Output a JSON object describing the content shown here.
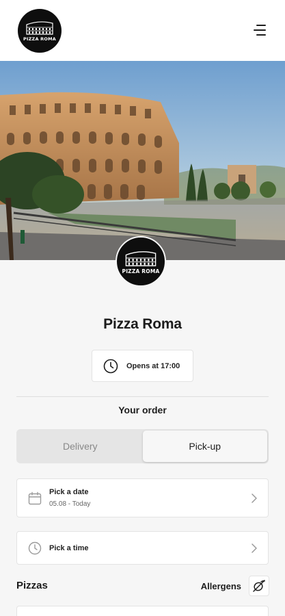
{
  "header": {
    "logo_text": "PIZZA ROMA",
    "menu_icon": "hamburger-menu-icon"
  },
  "hero": {
    "image": "colosseum-photo"
  },
  "restaurant": {
    "logo_text": "PIZZA ROMA",
    "name": "Pizza Roma",
    "hours": "Opens at 17:00",
    "hours_icon": "clock-icon"
  },
  "order": {
    "title": "Your order",
    "tabs": [
      {
        "label": "Delivery",
        "active": false
      },
      {
        "label": "Pick-up",
        "active": true
      }
    ],
    "date": {
      "icon": "calendar-icon",
      "title": "Pick a date",
      "value": "05.08 - Today"
    },
    "time": {
      "icon": "clock-icon",
      "title": "Pick a time"
    }
  },
  "menu": {
    "section_title": "Pizzas",
    "allergens_label": "Allergens",
    "allergens_icon": "allergens-filter-icon"
  },
  "colors": {
    "background": "#f6f6f6",
    "logo_bg": "#0e0e0e",
    "text": "#1c1c1c",
    "segment_bg": "#e5e5e5"
  }
}
